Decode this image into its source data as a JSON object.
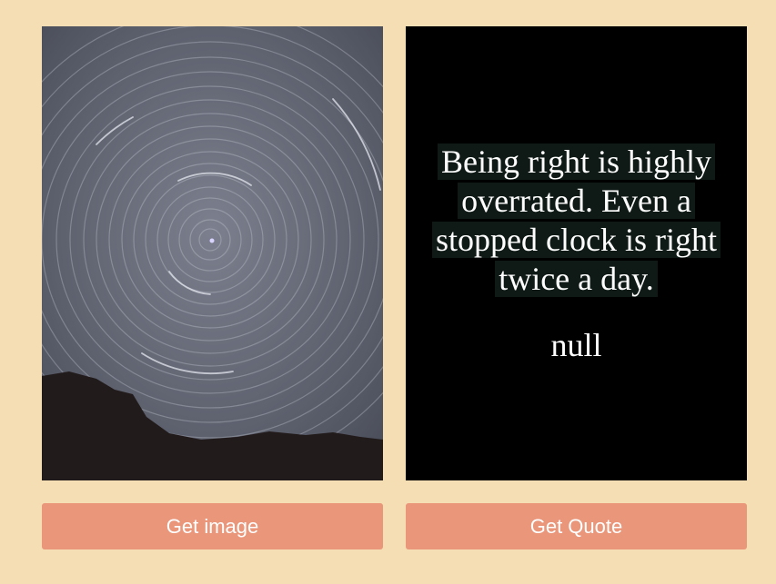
{
  "image": {
    "description_icon": "star-trails-photo"
  },
  "quote": {
    "text": "Being right is highly overrated. Even a stopped clock is right twice a day.",
    "author": "null"
  },
  "buttons": {
    "get_image": "Get image",
    "get_quote": "Get Quote"
  },
  "colors": {
    "background": "#f5deb3",
    "button": "#e9967a",
    "quote_card": "#000000"
  }
}
